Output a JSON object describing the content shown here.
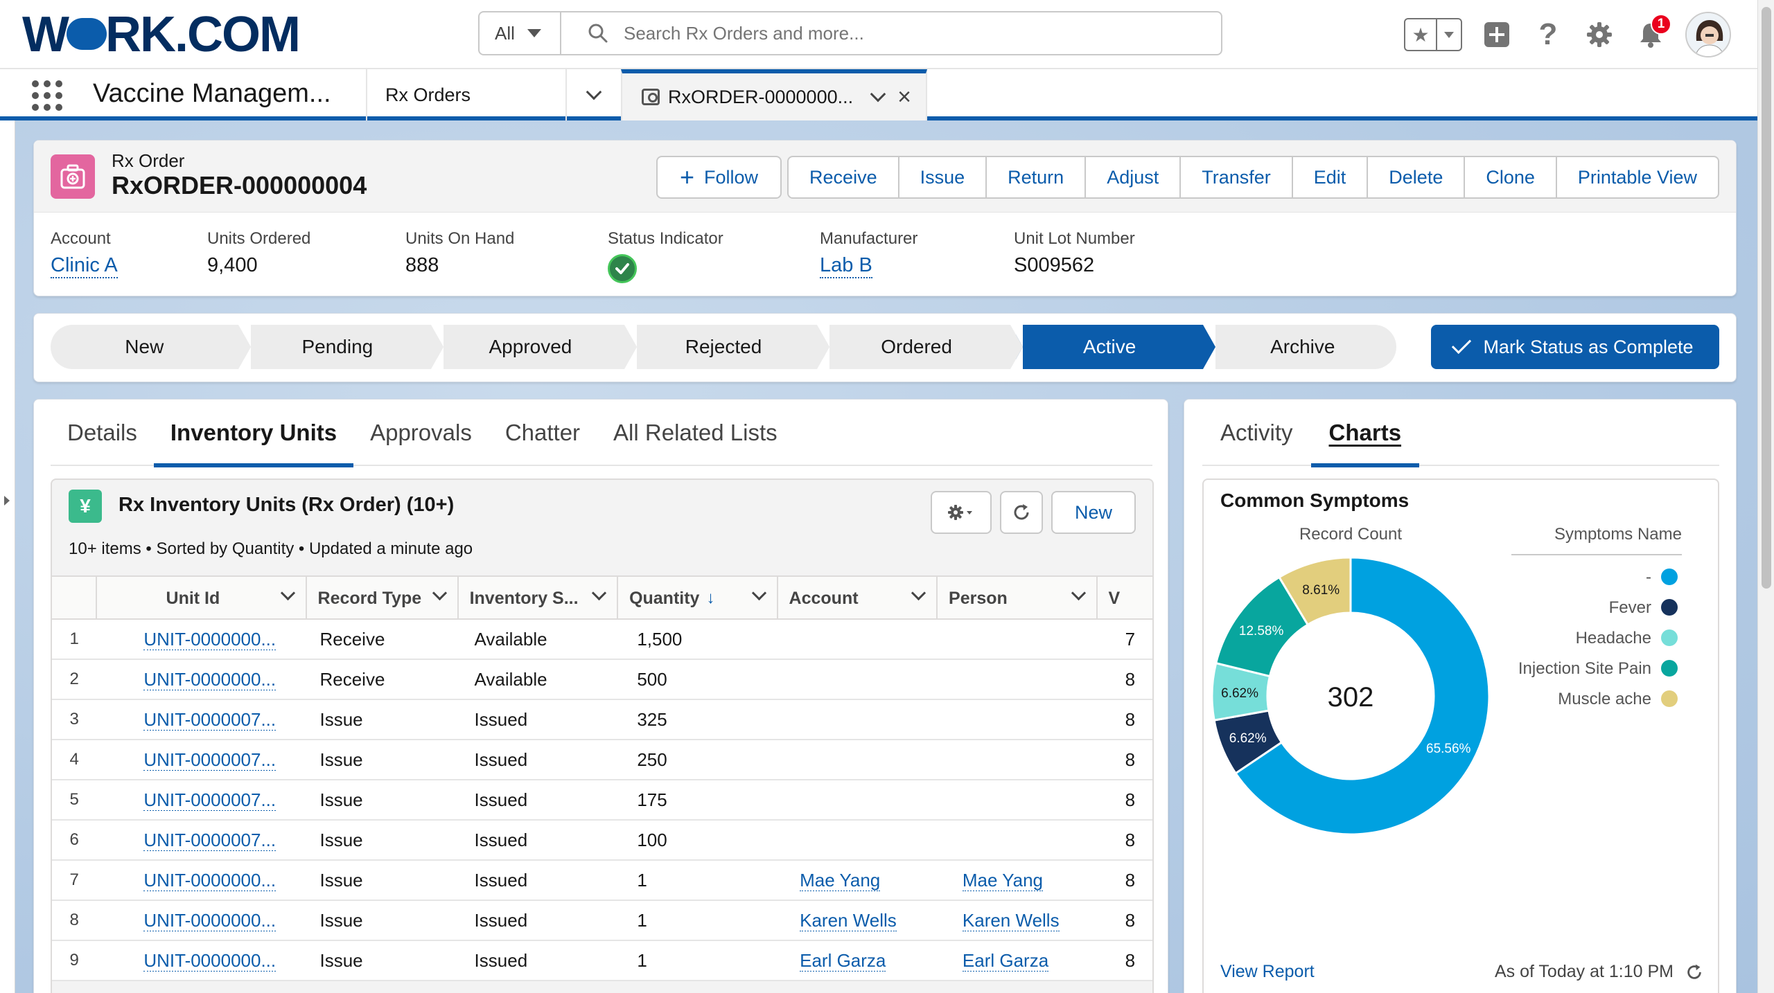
{
  "header": {
    "logo": "WORK.COM",
    "search": {
      "scope": "All",
      "placeholder": "Search Rx Orders and more..."
    },
    "notification_count": "1"
  },
  "nav": {
    "app_name": "Vaccine Managem...",
    "tabs": [
      {
        "label": "Rx Orders"
      },
      {
        "label": "RxORDER-0000000..."
      }
    ]
  },
  "record": {
    "type": "Rx Order",
    "name": "RxORDER-000000004",
    "buttons": [
      "Follow",
      "Receive",
      "Issue",
      "Return",
      "Adjust",
      "Transfer",
      "Edit",
      "Delete",
      "Clone",
      "Printable View"
    ],
    "fields": [
      {
        "label": "Account",
        "value": "Clinic A"
      },
      {
        "label": "Units Ordered",
        "value": "9,400"
      },
      {
        "label": "Units On Hand",
        "value": "888"
      },
      {
        "label": "Status Indicator",
        "value": ""
      },
      {
        "label": "Manufacturer",
        "value": "Lab B"
      },
      {
        "label": "Unit Lot Number",
        "value": "S009562"
      }
    ]
  },
  "path": {
    "stages": [
      "New",
      "Pending",
      "Approved",
      "Rejected",
      "Ordered",
      "Active",
      "Archive"
    ],
    "active": "Active",
    "mark_button": "Mark Status as Complete"
  },
  "main_tabs": [
    "Details",
    "Inventory Units",
    "Approvals",
    "Chatter",
    "All Related Lists"
  ],
  "related_list": {
    "title": "Rx Inventory Units (Rx Order) (10+)",
    "subtitle": "10+ items • Sorted by Quantity • Updated a minute ago",
    "new_label": "New",
    "columns": [
      "Unit Id",
      "Record Type",
      "Inventory S...",
      "Quantity",
      "Account",
      "Person"
    ],
    "rows": [
      {
        "n": "1",
        "unit": "UNIT-0000000...",
        "type": "Receive",
        "status": "Available",
        "qty": "1,500",
        "account": "",
        "person": "",
        "trail": "7"
      },
      {
        "n": "2",
        "unit": "UNIT-0000000...",
        "type": "Receive",
        "status": "Available",
        "qty": "500",
        "account": "",
        "person": "",
        "trail": "8"
      },
      {
        "n": "3",
        "unit": "UNIT-0000007...",
        "type": "Issue",
        "status": "Issued",
        "qty": "325",
        "account": "",
        "person": "",
        "trail": "8"
      },
      {
        "n": "4",
        "unit": "UNIT-0000007...",
        "type": "Issue",
        "status": "Issued",
        "qty": "250",
        "account": "",
        "person": "",
        "trail": "8"
      },
      {
        "n": "5",
        "unit": "UNIT-0000007...",
        "type": "Issue",
        "status": "Issued",
        "qty": "175",
        "account": "",
        "person": "",
        "trail": "8"
      },
      {
        "n": "6",
        "unit": "UNIT-0000007...",
        "type": "Issue",
        "status": "Issued",
        "qty": "100",
        "account": "",
        "person": "",
        "trail": "8"
      },
      {
        "n": "7",
        "unit": "UNIT-0000000...",
        "type": "Issue",
        "status": "Issued",
        "qty": "1",
        "account": "Mae Yang",
        "person": "Mae Yang",
        "trail": "8"
      },
      {
        "n": "8",
        "unit": "UNIT-0000000...",
        "type": "Issue",
        "status": "Issued",
        "qty": "1",
        "account": "Karen Wells",
        "person": "Karen Wells",
        "trail": "8"
      },
      {
        "n": "9",
        "unit": "UNIT-0000000...",
        "type": "Issue",
        "status": "Issued",
        "qty": "1",
        "account": "Earl Garza",
        "person": "Earl Garza",
        "trail": "8"
      }
    ]
  },
  "side_tabs": [
    "Activity",
    "Charts"
  ],
  "chart_panel": {
    "view_report": "View Report",
    "as_of": "As of Today at 1:10 PM"
  },
  "chart_data": {
    "type": "pie",
    "variant": "donut",
    "title": "Common Symptoms",
    "measure_label": "Record Count",
    "legend_title": "Symptoms Name",
    "total": "302",
    "slices": [
      {
        "name": "-",
        "percent": 65.56,
        "label": "65.56%",
        "color": "#00a1e0"
      },
      {
        "name": "Fever",
        "percent": 6.62,
        "label": "6.62%",
        "color": "#16325c"
      },
      {
        "name": "Headache",
        "percent": 6.62,
        "label": "6.62%",
        "color": "#76ded9"
      },
      {
        "name": "Injection Site Pain",
        "percent": 12.58,
        "label": "12.58%",
        "color": "#08a69e"
      },
      {
        "name": "Muscle ache",
        "percent": 8.61,
        "label": "8.61%",
        "color": "#e2ce7d"
      }
    ]
  },
  "colors": {
    "brand": "#0b5cab",
    "path_active": "#0b5cab",
    "record_icon": "#e3669f",
    "related_icon": "#3bba8c"
  }
}
